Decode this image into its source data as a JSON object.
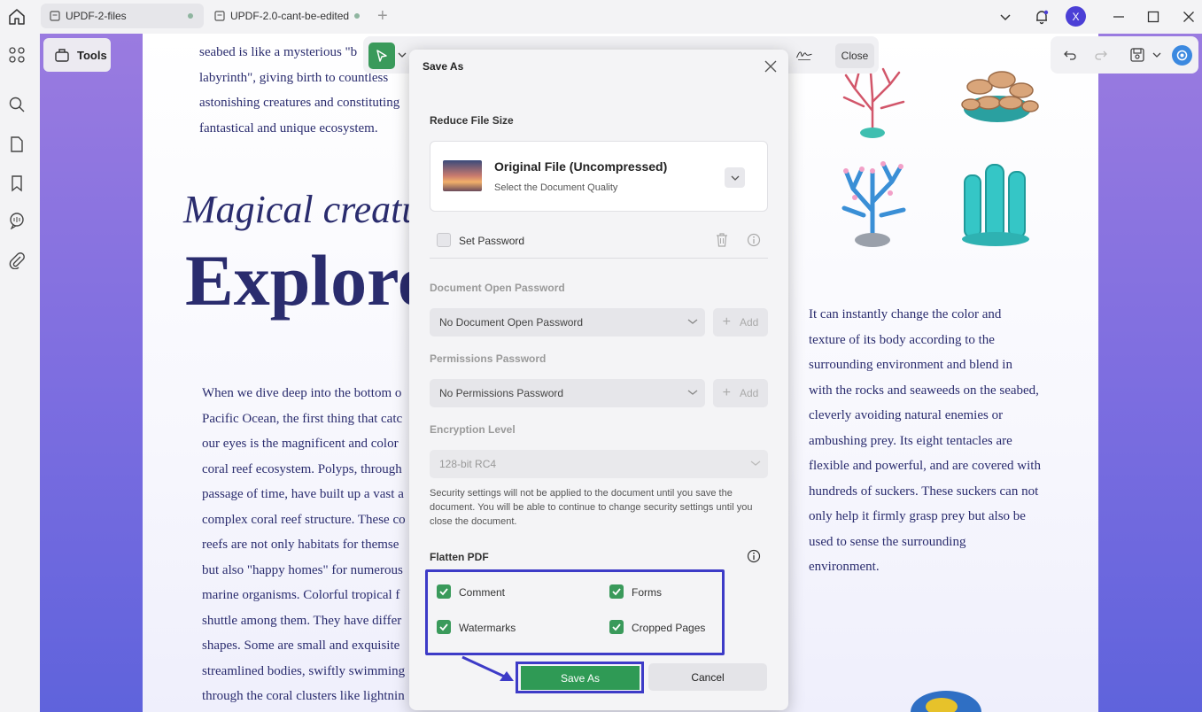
{
  "tabs": [
    {
      "label": "UPDF-2-files"
    },
    {
      "label": "UPDF-2.0-cant-be-edited"
    }
  ],
  "user": {
    "initial": "X"
  },
  "toolbar": {
    "tools_label": "Tools",
    "close_label": "Close"
  },
  "document": {
    "left_top_lines": [
      "seabed is like a mysterious \"b",
      "labyrinth\", giving birth to countless",
      "astonishing creatures and constituting",
      "fantastical and unique ecosystem."
    ],
    "italic_title": "Magical creatu",
    "big_title": "Explore",
    "left_body_lines": [
      "When we dive deep into the bottom o",
      "Pacific Ocean, the first thing that catc",
      "our eyes is the magnificent and color",
      "coral reef ecosystem. Polyps, through",
      "passage of time, have built up a vast a",
      "complex coral reef structure. These co",
      "reefs are not only habitats for themse",
      "but also \"happy homes\" for numerous",
      "marine organisms. Colorful tropical f",
      "shuttle among them. They have differ",
      "shapes. Some are small and exquisite",
      "streamlined bodies, swiftly swimming",
      "through the coral clusters like lightnin"
    ],
    "right_body_lines": [
      "It can instantly change the color and",
      "texture of its body according to the",
      "surrounding environment and blend in",
      "with the rocks and seaweeds on the seabed,",
      "cleverly avoiding natural enemies or",
      "ambushing prey. Its eight tentacles are",
      "flexible and powerful, and are covered with",
      "hundreds of suckers. These suckers can not",
      "only help it firmly grasp prey but also be",
      "used to sense the surrounding",
      "environment."
    ]
  },
  "dialog": {
    "title": "Save As",
    "reduce_label": "Reduce File Size",
    "quality_title": "Original File (Uncompressed)",
    "quality_sub": "Select the Document Quality",
    "set_password_label": "Set Password",
    "open_pw_label": "Document Open Password",
    "open_pw_value": "No Document Open Password",
    "perm_pw_label": "Permissions Password",
    "perm_pw_value": "No Permissions Password",
    "add_label": "Add",
    "enc_label": "Encryption Level",
    "enc_value": "128-bit RC4",
    "note": "Security settings will not be applied to the document until you save the document. You will be able to continue to change security settings until you close the document.",
    "flatten_label": "Flatten PDF",
    "flatten_options": [
      {
        "label": "Comment",
        "checked": true
      },
      {
        "label": "Forms",
        "checked": true
      },
      {
        "label": "Watermarks",
        "checked": true
      },
      {
        "label": "Cropped Pages",
        "checked": true
      }
    ],
    "save_label": "Save As",
    "cancel_label": "Cancel"
  },
  "colors": {
    "accent_green": "#2f9a55",
    "highlight_blue": "#3d3bc7",
    "text_navy": "#2a2c6e"
  }
}
